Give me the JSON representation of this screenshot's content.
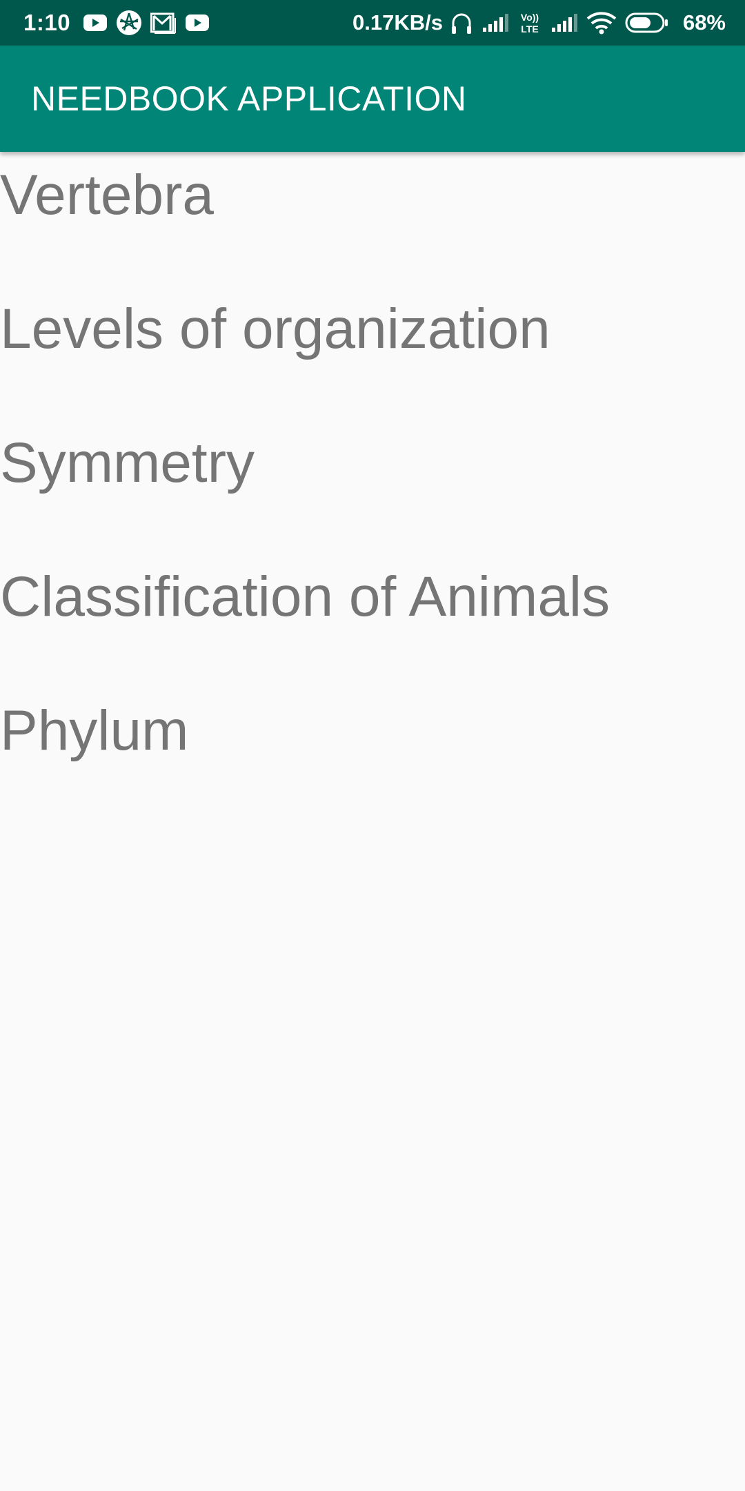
{
  "status_bar": {
    "time": "1:10",
    "notification_icons": [
      "youtube-icon",
      "aperture-icon",
      "gmail-icon",
      "youtube-icon"
    ],
    "network_speed": "0.17KB/s",
    "volte_label_top": "Vo))",
    "volte_label_bottom": "LTE",
    "battery_percent": "68%",
    "battery_level": 0.68
  },
  "app_bar": {
    "title": "NEEDBOOK APPLICATION"
  },
  "topics": [
    {
      "label": "Vertebra"
    },
    {
      "label": "Levels of organization"
    },
    {
      "label": "Symmetry"
    },
    {
      "label": "Classification of Animals"
    },
    {
      "label": "Phylum"
    }
  ],
  "colors": {
    "status_bar": "#00574b",
    "app_bar": "#008577",
    "background": "#fafafa",
    "list_text": "#757575"
  }
}
